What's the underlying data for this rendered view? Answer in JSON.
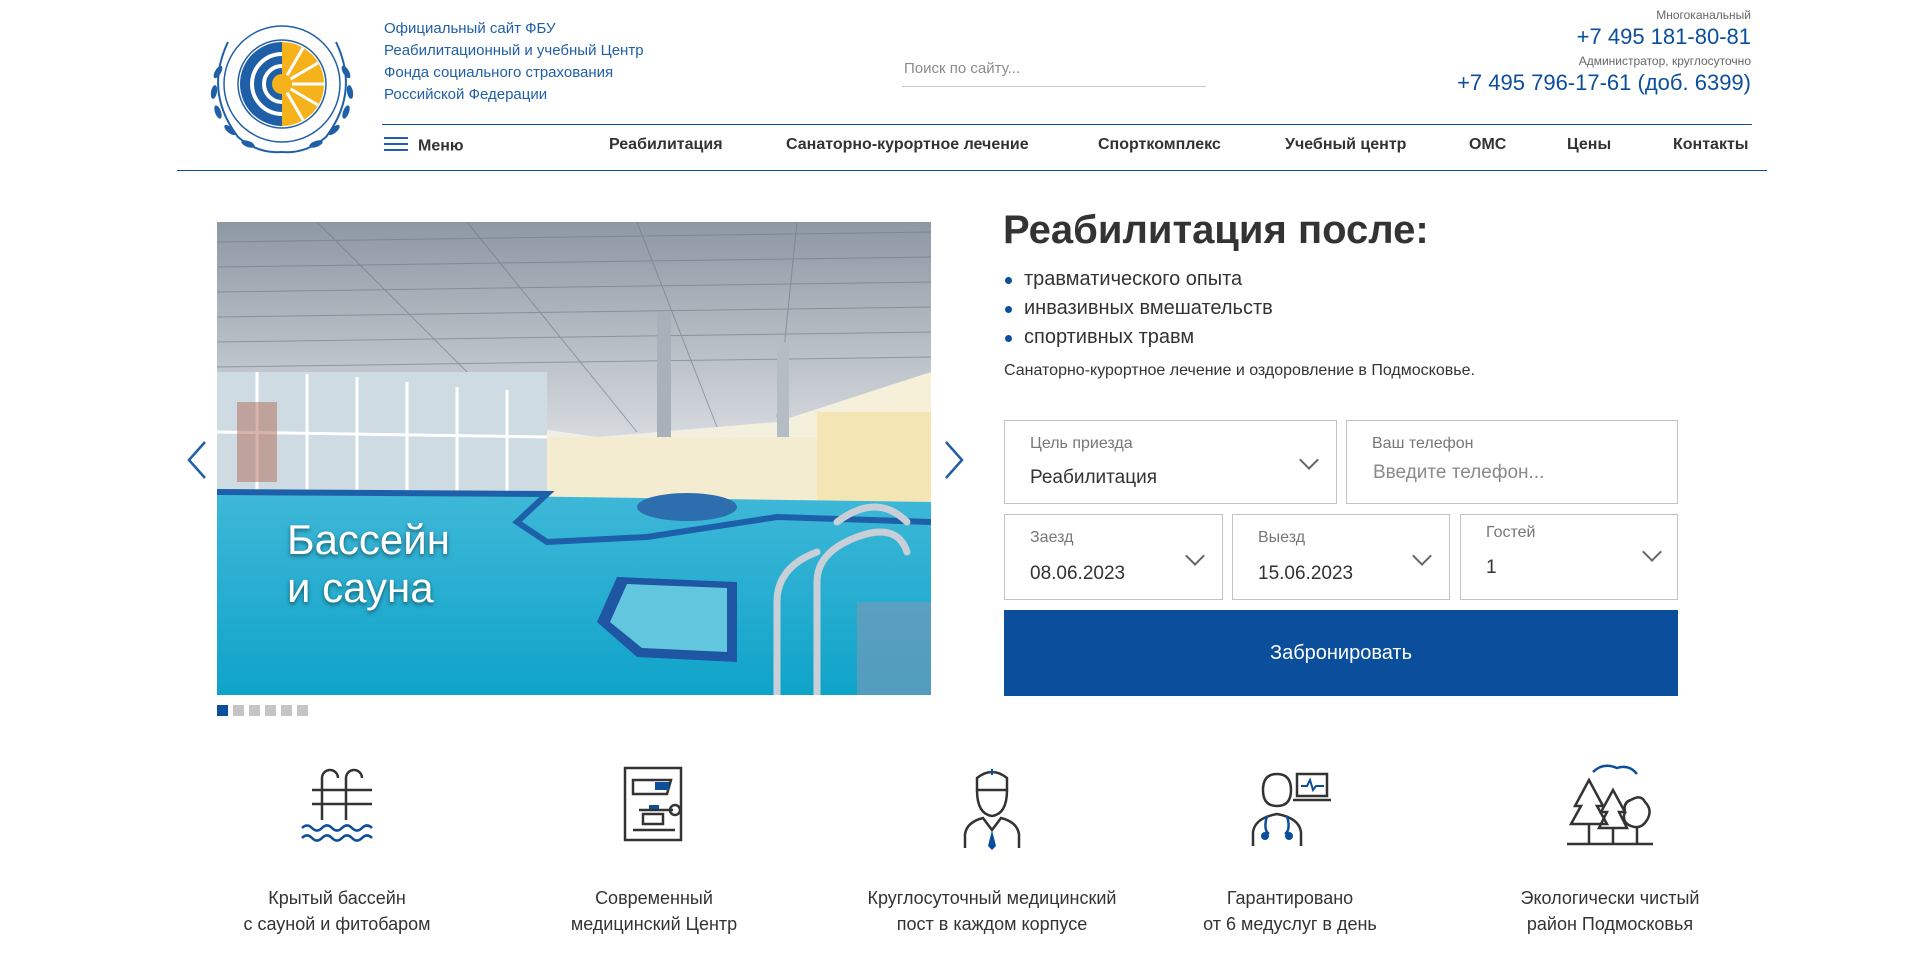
{
  "header": {
    "org_lines": [
      "Официальный сайт ФБУ",
      "Реабилитационный и учебный Центр",
      "Фонда социального страхования",
      "Российской Федерации"
    ],
    "search_placeholder": "Поиск по сайту...",
    "phone1_label": "Многоканальный",
    "phone1": "+7 495 181-80-81",
    "phone2_label": "Администратор, круглосуточно",
    "phone2": "+7 495 796-17-61 (доб. 6399)"
  },
  "nav": {
    "menu_label": "Меню",
    "items": [
      "Реабилитация",
      "Санаторно-курортное лечение",
      "Спорткомплекс",
      "Учебный центр",
      "ОМС",
      "Цены",
      "Контакты"
    ]
  },
  "slider": {
    "caption_line1": "Бассейн",
    "caption_line2": "и сауна",
    "dots": [
      true,
      false,
      false,
      false,
      false,
      false
    ]
  },
  "booking": {
    "title": "Реабилитация после:",
    "bullets": [
      "травматического опыта",
      "инвазивных вмешательств",
      "спортивных травм"
    ],
    "subtitle": "Санаторно-курортное лечение и оздоровление в Подмосковье.",
    "purpose_label": "Цель приезда",
    "purpose_value": "Реабилитация",
    "phone_label": "Ваш телефон",
    "phone_placeholder": "Введите телефон...",
    "checkin_label": "Заезд",
    "checkin_value": "08.06.2023",
    "checkout_label": "Выезд",
    "checkout_value": "15.06.2023",
    "guests_label": "Гостей",
    "guests_value": "1",
    "button_label": "Забронировать"
  },
  "features": [
    {
      "line1": "Крытый бассейн",
      "line2": "с сауной и фитобаром",
      "icon": "pool-ladder-icon"
    },
    {
      "line1": "Современный",
      "line2": "медицинский Центр",
      "icon": "medical-equipment-icon"
    },
    {
      "line1": "Круглосуточный медицинский",
      "line2": "пост в каждом корпусе",
      "icon": "doctor-icon"
    },
    {
      "line1": "Гарантировано",
      "line2": "от 6 медуслуг в день",
      "icon": "stethoscope-doctor-icon"
    },
    {
      "line1": "Экологически чистый",
      "line2": "район Подмосковья",
      "icon": "forest-icon"
    }
  ],
  "colors": {
    "brand_blue": "#0b4e9c",
    "sun_yellow": "#f5b21b"
  }
}
